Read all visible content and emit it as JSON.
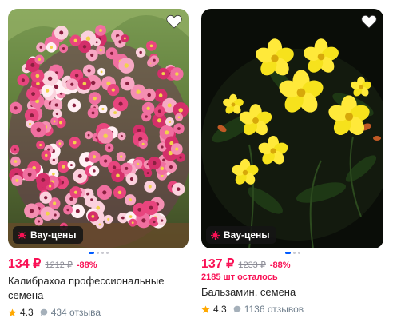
{
  "products": [
    {
      "price": "134 ₽",
      "old_price": "1212 ₽",
      "discount": "-88%",
      "stock": "",
      "title": "Калибрахоа профессиональные семена",
      "rating": "4.3",
      "reviews": "434 отзыва",
      "badge": "Вау-цены",
      "image": "pink calibrachoa flowers in a basket"
    },
    {
      "price": "137 ₽",
      "old_price": "1233 ₽",
      "discount": "-88%",
      "stock": "2185 шт осталось",
      "title": "Бальзамин, семена",
      "rating": "4.3",
      "reviews": "1136 отзывов",
      "badge": "Вау-цены",
      "image": "yellow flowers on dark background"
    }
  ],
  "icons": {
    "favorite": "heart-icon",
    "badge": "lightning-icon",
    "rating": "star-icon",
    "reviews": "chat-bubble-icon"
  },
  "colors": {
    "price": "#f91155",
    "badge_bg": "#141414",
    "dot_active": "#005bff",
    "star": "#ffa800"
  }
}
